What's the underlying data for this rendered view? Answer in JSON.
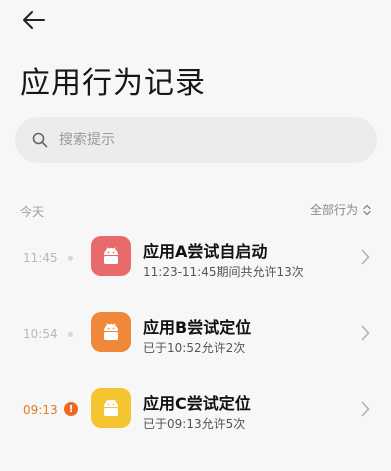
{
  "header": {
    "back_icon": "arrow-left-icon",
    "title": "应用行为记录"
  },
  "search": {
    "icon": "search-icon",
    "placeholder": "搜索提示",
    "value": ""
  },
  "section": {
    "label": "今天",
    "filter_label": "全部行为",
    "filter_icon": "chevron-updown-icon"
  },
  "records": [
    {
      "time": "11:45",
      "marker": "dot",
      "icon": "android-icon",
      "icon_color": "#e86a6a",
      "title": "应用A尝试自启动",
      "subtitle": "11:23-11:45期间共允许13次"
    },
    {
      "time": "10:54",
      "marker": "dot",
      "icon": "android-icon",
      "icon_color": "#f0883a",
      "title": "应用B尝试定位",
      "subtitle": "已于10:52允许2次"
    },
    {
      "time": "09:13",
      "marker": "alert",
      "alert_text": "!",
      "alert_color": "#ec6a22",
      "icon": "android-icon",
      "icon_color": "#f5c531",
      "title": "应用C尝试定位",
      "subtitle": "已于09:13允许5次"
    }
  ]
}
